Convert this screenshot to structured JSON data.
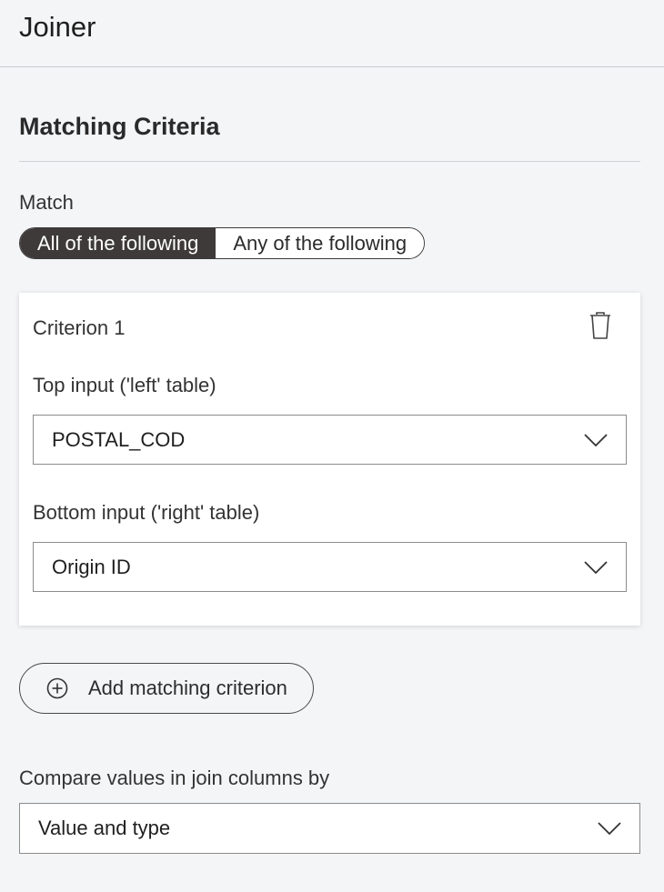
{
  "header": {
    "title": "Joiner"
  },
  "section": {
    "title": "Matching Criteria"
  },
  "match": {
    "label": "Match",
    "options": [
      "All of the following",
      "Any of the following"
    ],
    "selected": "All of the following"
  },
  "criteria": [
    {
      "title": "Criterion 1",
      "delete_icon": "trash-icon",
      "top_label": "Top input ('left' table)",
      "top_value": "POSTAL_COD",
      "bottom_label": "Bottom input ('right' table)",
      "bottom_value": "Origin ID"
    }
  ],
  "add_button": {
    "label": "Add matching criterion",
    "icon": "plus-circle-icon"
  },
  "compare": {
    "label": "Compare values in join columns by",
    "value": "Value and type"
  },
  "colors": {
    "segment_active_bg": "#3d3a39",
    "background": "#f4f5f7"
  }
}
